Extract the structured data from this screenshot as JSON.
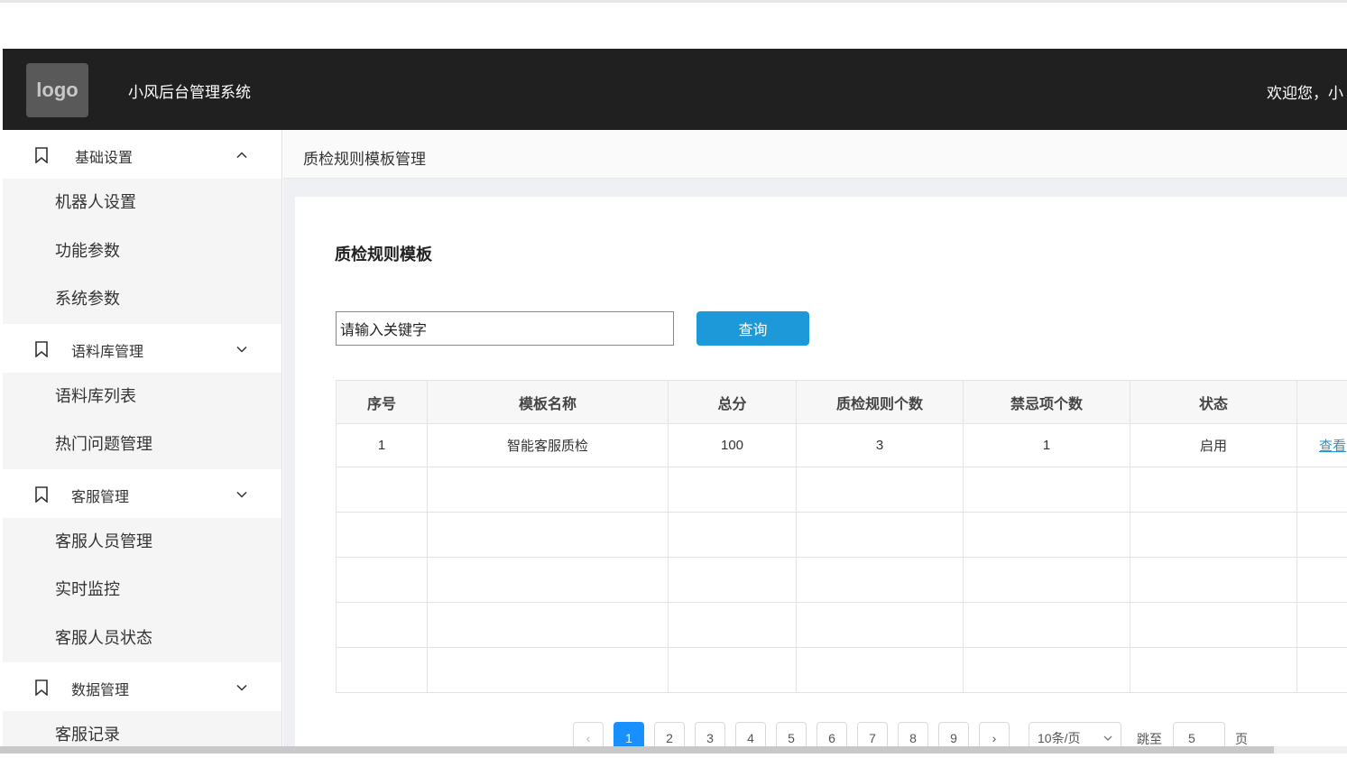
{
  "header": {
    "logo_text": "logo",
    "app_title": "小风后台管理系统",
    "welcome": "欢迎您，小"
  },
  "sidebar": {
    "groups": [
      {
        "label": "基础设置",
        "expanded": true,
        "icon": "bookmark-icon",
        "items": [
          "机器人设置",
          "功能参数",
          "系统参数"
        ]
      },
      {
        "label": "语料库管理",
        "expanded": false,
        "icon": "bookmark-icon",
        "items": [
          "语料库列表",
          "热门问题管理"
        ]
      },
      {
        "label": "客服管理",
        "expanded": false,
        "icon": "bookmark-icon",
        "items": [
          "客服人员管理",
          "实时监控",
          "客服人员状态"
        ]
      },
      {
        "label": "数据管理",
        "expanded": false,
        "icon": "bookmark-icon",
        "items": [
          "客服记录"
        ]
      }
    ]
  },
  "breadcrumb": {
    "title": "质检规则模板管理"
  },
  "card": {
    "title": "质检规则模板",
    "search": {
      "value": "请输入关键字",
      "button": "查询"
    }
  },
  "table": {
    "headers": [
      "序号",
      "模板名称",
      "总分",
      "质检规则个数",
      "禁忌项个数",
      "状态",
      ""
    ],
    "rows": [
      {
        "index": "1",
        "name": "智能客服质检",
        "score": "100",
        "rule_count": "3",
        "taboo_count": "1",
        "status": "启用",
        "action": "查看"
      }
    ]
  },
  "pagination": {
    "prev": "‹",
    "pages": [
      "1",
      "2",
      "3",
      "4",
      "5",
      "6",
      "7",
      "8",
      "9"
    ],
    "current": "1",
    "next": "›",
    "page_size": "10条/页",
    "jump_label": "跳至",
    "jump_value": "5",
    "page_suffix": "页"
  },
  "colors": {
    "header_bg": "#202020",
    "accent": "#1d98d8",
    "pager_active": "#1890ff"
  }
}
